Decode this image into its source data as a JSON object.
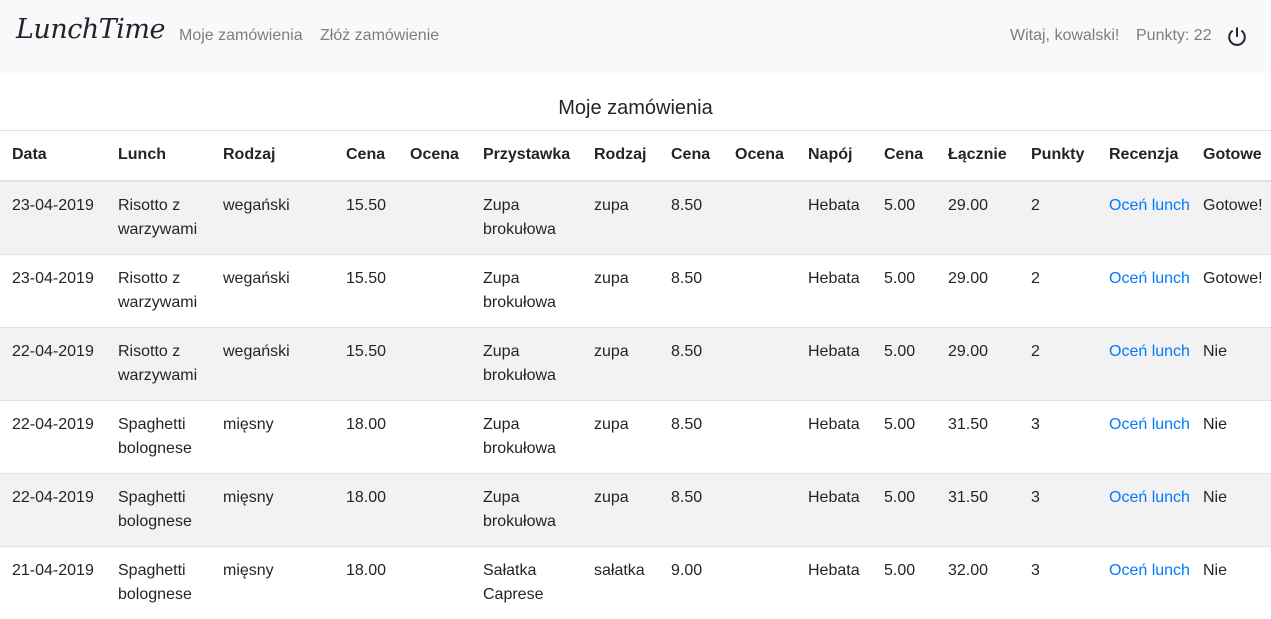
{
  "navbar": {
    "brand": "LunchTime",
    "links": [
      "Moje zamówienia",
      "Złóż zamówienie"
    ],
    "greeting": "Witaj, kowalski!",
    "points": "Punkty: 22",
    "logout_icon": "power-icon"
  },
  "page_title": "Moje zamówienia",
  "table": {
    "headers": [
      "Data",
      "Lunch",
      "Rodzaj",
      "Cena",
      "Ocena",
      "Przystawka",
      "Rodzaj",
      "Cena",
      "Ocena",
      "Napój",
      "Cena",
      "Łącznie",
      "Punkty",
      "Recenzja",
      "Gotowe"
    ],
    "rows": [
      {
        "date": "23-04-2019",
        "lunch": "Risotto z warzywami",
        "lunch_type": "wegański",
        "lunch_price": "15.50",
        "lunch_rating": "",
        "starter": "Zupa brokułowa",
        "starter_type": "zupa",
        "starter_price": "8.50",
        "starter_rating": "",
        "drink": "Hebata",
        "drink_price": "5.00",
        "total": "29.00",
        "points": "2",
        "review": "Oceń lunch",
        "ready": "Gotowe!"
      },
      {
        "date": "23-04-2019",
        "lunch": "Risotto z warzywami",
        "lunch_type": "wegański",
        "lunch_price": "15.50",
        "lunch_rating": "",
        "starter": "Zupa brokułowa",
        "starter_type": "zupa",
        "starter_price": "8.50",
        "starter_rating": "",
        "drink": "Hebata",
        "drink_price": "5.00",
        "total": "29.00",
        "points": "2",
        "review": "Oceń lunch",
        "ready": "Gotowe!"
      },
      {
        "date": "22-04-2019",
        "lunch": "Risotto z warzywami",
        "lunch_type": "wegański",
        "lunch_price": "15.50",
        "lunch_rating": "",
        "starter": "Zupa brokułowa",
        "starter_type": "zupa",
        "starter_price": "8.50",
        "starter_rating": "",
        "drink": "Hebata",
        "drink_price": "5.00",
        "total": "29.00",
        "points": "2",
        "review": "Oceń lunch",
        "ready": "Nie"
      },
      {
        "date": "22-04-2019",
        "lunch": "Spaghetti bolognese",
        "lunch_type": "mięsny",
        "lunch_price": "18.00",
        "lunch_rating": "",
        "starter": "Zupa brokułowa",
        "starter_type": "zupa",
        "starter_price": "8.50",
        "starter_rating": "",
        "drink": "Hebata",
        "drink_price": "5.00",
        "total": "31.50",
        "points": "3",
        "review": "Oceń lunch",
        "ready": "Nie"
      },
      {
        "date": "22-04-2019",
        "lunch": "Spaghetti bolognese",
        "lunch_type": "mięsny",
        "lunch_price": "18.00",
        "lunch_rating": "",
        "starter": "Zupa brokułowa",
        "starter_type": "zupa",
        "starter_price": "8.50",
        "starter_rating": "",
        "drink": "Hebata",
        "drink_price": "5.00",
        "total": "31.50",
        "points": "3",
        "review": "Oceń lunch",
        "ready": "Nie"
      },
      {
        "date": "21-04-2019",
        "lunch": "Spaghetti bolognese",
        "lunch_type": "mięsny",
        "lunch_price": "18.00",
        "lunch_rating": "",
        "starter": "Sałatka Caprese",
        "starter_type": "sałatka",
        "starter_price": "9.00",
        "starter_rating": "",
        "drink": "Hebata",
        "drink_price": "5.00",
        "total": "32.00",
        "points": "3",
        "review": "Oceń lunch",
        "ready": "Nie"
      }
    ]
  },
  "colors": {
    "navbar_bg": "#f8f9fa",
    "link": "#007bff",
    "stripe": "#f2f2f2"
  }
}
